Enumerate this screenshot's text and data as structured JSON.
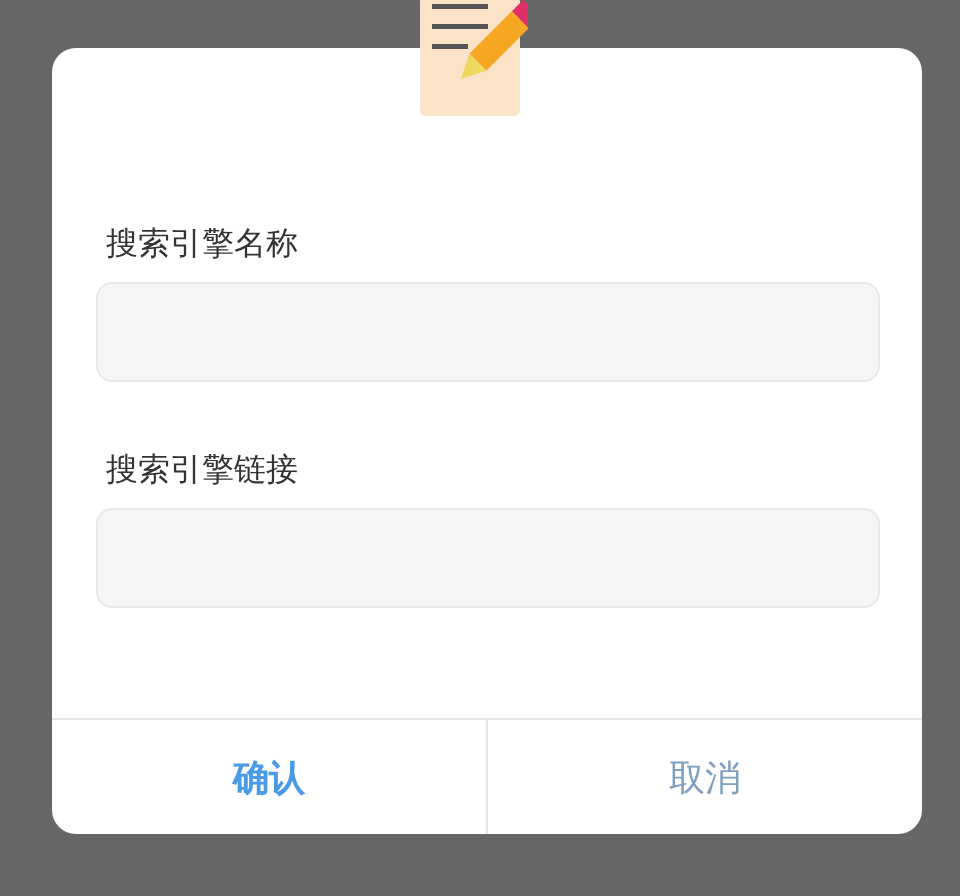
{
  "dialog": {
    "fields": [
      {
        "label": "搜索引擎名称"
      },
      {
        "label": "搜索引擎链接"
      }
    ],
    "buttons": [
      {
        "label": "确认",
        "kind": "primary"
      },
      {
        "label": "取消",
        "kind": "secondary"
      }
    ]
  }
}
